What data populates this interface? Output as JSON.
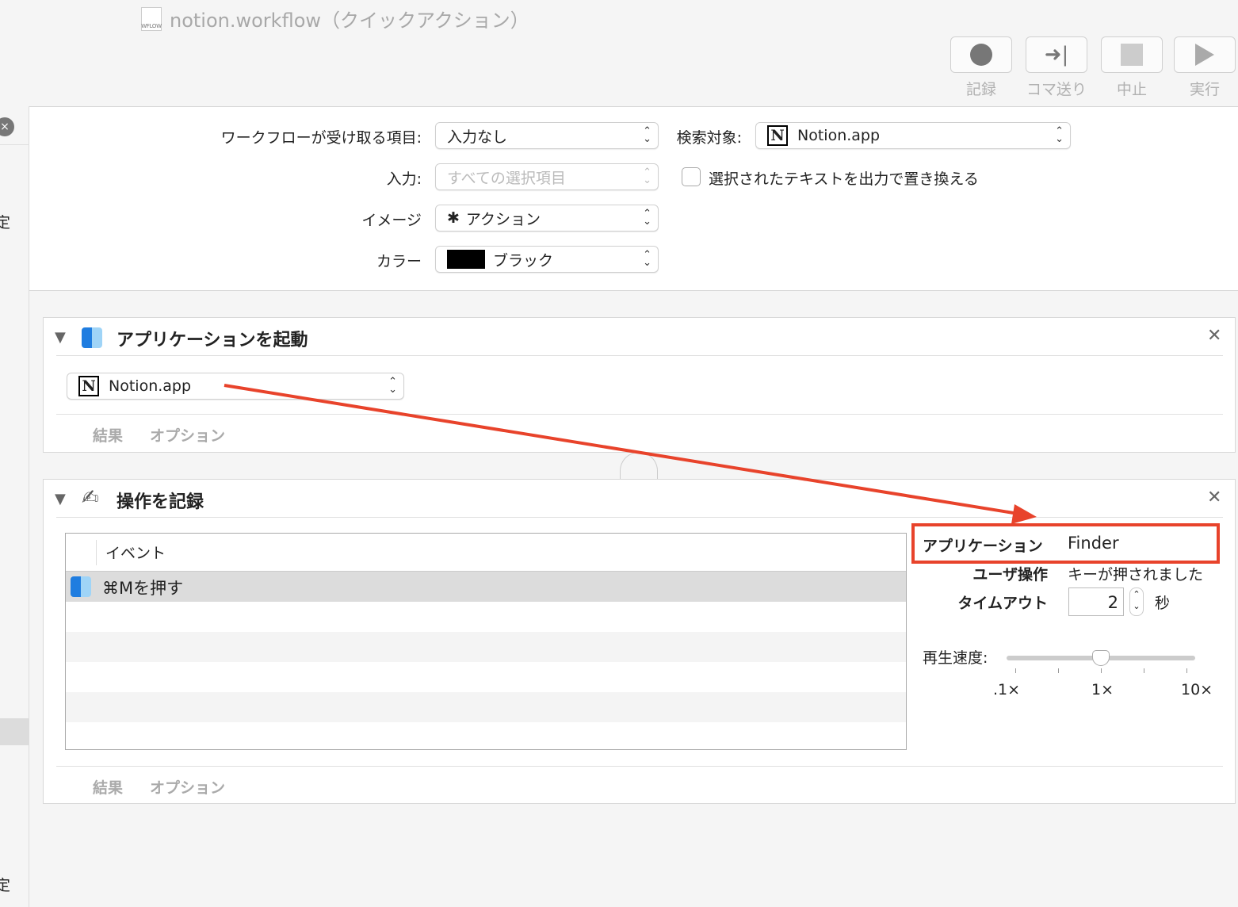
{
  "window": {
    "title": "notion.workflow（クイックアクション）",
    "doc_icon_label": "WFLOW"
  },
  "toolbar": [
    {
      "label": "記録",
      "icon": "record-icon"
    },
    {
      "label": "コマ送り",
      "icon": "step-icon"
    },
    {
      "label": "中止",
      "icon": "stop-icon"
    },
    {
      "label": "実行",
      "icon": "run-icon"
    }
  ],
  "sidebar": {
    "text1": "定",
    "text2": "定"
  },
  "settings": {
    "receives_label": "ワークフローが受け取る項目:",
    "receives_value": "入力なし",
    "search_label": "検索対象:",
    "search_value": "Notion.app",
    "input_label": "入力:",
    "input_value": "すべての選択項目",
    "replace_label": "選択されたテキストを出力で置き換える",
    "image_label": "イメージ",
    "image_value": "アクション",
    "color_label": "カラー",
    "color_value": "ブラック",
    "color_swatch": "#000000"
  },
  "action1": {
    "title": "アプリケーションを起動",
    "app": "Notion.app",
    "tab_results": "結果",
    "tab_options": "オプション"
  },
  "action2": {
    "title": "操作を記録",
    "column": "イベント",
    "events": [
      "⌘Mを押す"
    ],
    "app_label": "アプリケーション",
    "app_value": "Finder",
    "user_label": "ユーザ操作",
    "user_value": "キーが押されました",
    "timeout_label": "タイムアウト",
    "timeout_value": "2",
    "timeout_unit": "秒",
    "speed_label": "再生速度:",
    "speed_ticks": [
      ".1×",
      "1×",
      "10×"
    ],
    "speed_value": "1×",
    "tab_results": "結果",
    "tab_options": "オプション"
  },
  "annotation_color": "#e8432b"
}
